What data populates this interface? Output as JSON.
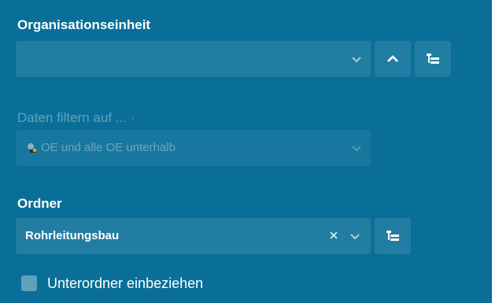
{
  "org_unit": {
    "label": "Organisationseinheit",
    "value": "",
    "icons": [
      "chevron-down-icon",
      "chevron-up-icon",
      "tree-icon"
    ]
  },
  "filter": {
    "label": "Daten filtern auf ... ·",
    "value": "OE und alle OE unterhalb",
    "icons": [
      "org-unit-icon",
      "chevron-down-icon"
    ]
  },
  "folder": {
    "label": "Ordner",
    "value": "Rohrleitungsbau",
    "icons": [
      "clear-icon",
      "chevron-down-icon",
      "tree-icon"
    ]
  },
  "subfolders": {
    "label": "Unterordner einbeziehen",
    "checked": false
  },
  "colors": {
    "background": "#0a6f98",
    "text": "#ffffff"
  }
}
